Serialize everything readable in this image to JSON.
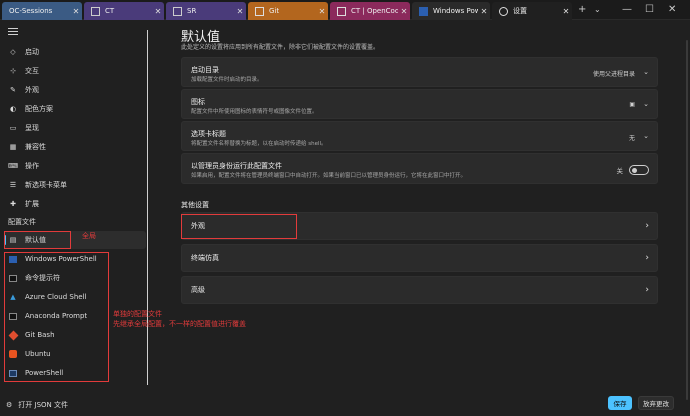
{
  "tabs": [
    {
      "label": "OC-Sessions",
      "color": "#3b5b84"
    },
    {
      "label": "CT",
      "color": "#4a3b7a"
    },
    {
      "label": "SR",
      "color": "#4a3b7a"
    },
    {
      "label": "Git",
      "color": "#b3661e"
    },
    {
      "label": "CT | OpenCode",
      "color": "#8b2a5c"
    },
    {
      "label": "Windows PowerSh",
      "color": "#2a2a2a"
    },
    {
      "label": "设置",
      "color": "#202020"
    }
  ],
  "sidebar": {
    "items": [
      {
        "label": "启动"
      },
      {
        "label": "交互"
      },
      {
        "label": "外观"
      },
      {
        "label": "配色方案"
      },
      {
        "label": "呈现"
      },
      {
        "label": "兼容性"
      },
      {
        "label": "操作"
      },
      {
        "label": "新选项卡菜单"
      },
      {
        "label": "扩展"
      }
    ],
    "profiles_section": "配置文件",
    "profiles": [
      {
        "label": "默认值"
      },
      {
        "label": "Windows PowerShell"
      },
      {
        "label": "命令提示符"
      },
      {
        "label": "Azure Cloud Shell"
      },
      {
        "label": "Anaconda Prompt"
      },
      {
        "label": "Git Bash"
      },
      {
        "label": "Ubuntu"
      },
      {
        "label": "PowerShell"
      }
    ],
    "open_json": "打开 JSON 文件"
  },
  "main": {
    "title": "默认值",
    "description": "此处定义的设置将应用到所有配置文件，除非它们被配置文件的设置覆盖。",
    "cards": [
      {
        "title": "启动目录",
        "sub": "加载配置文件时启动的目录。",
        "value": "使用父进程目录"
      },
      {
        "title": "图标",
        "sub": "配置文件中所使用图标的表情符号或图像文件位置。",
        "value": "▣"
      },
      {
        "title": "选项卡标题",
        "sub": "将配置文件名称替换为标题，以在启动时传递给 shell。",
        "value": "无"
      },
      {
        "title": "以管理员身份运行此配置文件",
        "sub": "如果启用，配置文件将在管理员终端窗口中自动打开。如果当前窗口已以管理员身份运行，它将在此窗口中打开。",
        "toggle_label": "关"
      }
    ],
    "other_section": "其他设置",
    "links": [
      {
        "label": "外观"
      },
      {
        "label": "终端仿真"
      },
      {
        "label": "高级"
      }
    ],
    "save": "保存",
    "discard": "放弃更改"
  },
  "annotations": {
    "global": "全局",
    "profiles_note_1": "单独的配置文件",
    "profiles_note_2": "先继承全局配置，不一样的配置值进行覆盖"
  },
  "accent": "#4cc2ff",
  "annotation_color": "#e23b3b"
}
